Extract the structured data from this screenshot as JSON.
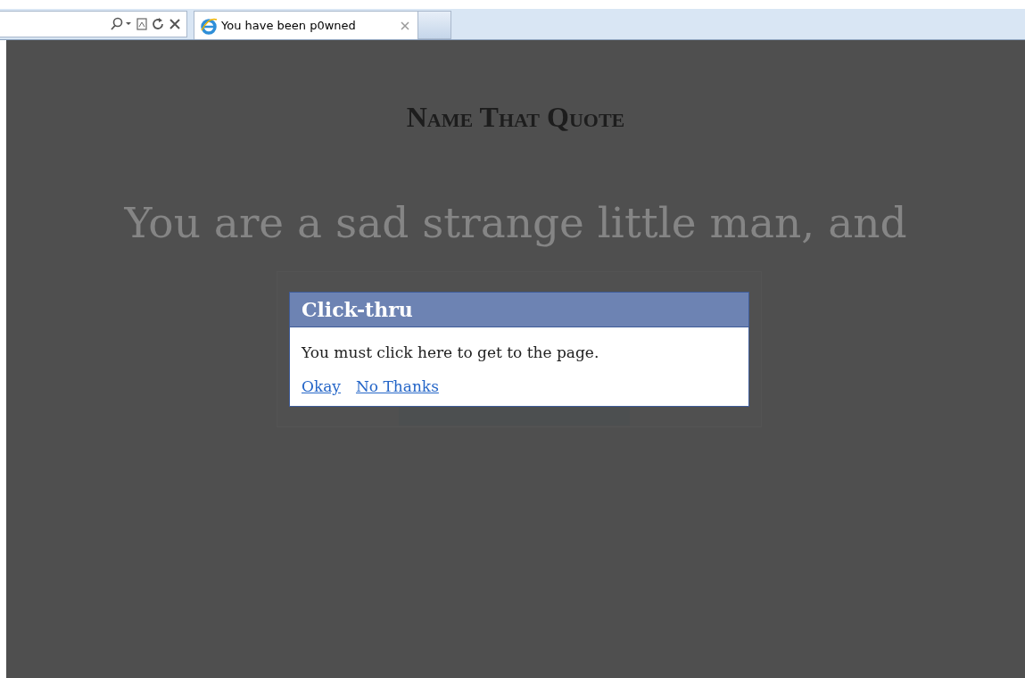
{
  "browser": {
    "tab": {
      "title": "You have been p0wned",
      "selected": true
    }
  },
  "page": {
    "heading": "Name That Quote",
    "quote_lines": [
      "You are a sad strange little man, and"
    ]
  },
  "dialog": {
    "title": "Click-thru",
    "message": "You must click here to get to the page.",
    "links": [
      {
        "label": "Okay"
      },
      {
        "label": "No Thanks"
      }
    ]
  }
}
